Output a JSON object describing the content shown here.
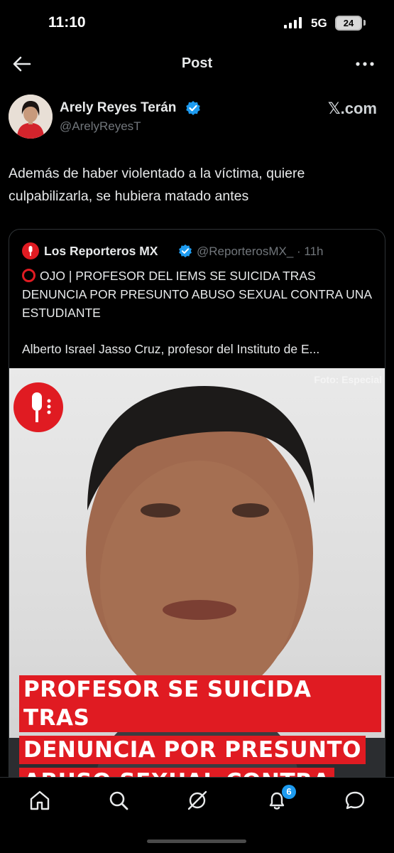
{
  "status_bar": {
    "time": "11:10",
    "network": "5G",
    "battery": "24"
  },
  "header": {
    "title": "Post"
  },
  "author": {
    "name": "Arely Reyes Terán",
    "handle": "@ArelyReyesT",
    "watermark": "𝕏.com"
  },
  "tweet": {
    "text": "Además de haber violentado a la víctima, quiere culpabilizarla, se hubiera matado antes"
  },
  "quote": {
    "name": "Los Reporteros MX",
    "handle": "@ReporterosMX_ · 11h",
    "text": "OJO | PROFESOR DEL IEMS SE SUICIDA TRAS DENUNCIA POR PRESUNTO ABUSO SEXUAL CONTRA UNA ESTUDIANTE",
    "excerpt": "Alberto Israel Jasso Cruz, profesor del Instituto de E...",
    "media": {
      "photo_credit": "Foto: Especial",
      "headline": [
        "PROFESOR SE SUICIDA TRAS",
        "DENUNCIA POR PRESUNTO",
        "ABUSO SEXUAL CONTRA"
      ]
    }
  },
  "nav": {
    "notifications_badge": "6",
    "icons": [
      "home-icon",
      "search-icon",
      "grok-icon",
      "notifications-icon",
      "messages-icon"
    ]
  },
  "colors": {
    "accent": "#1d9bf0",
    "brand_red": "#e01b22",
    "background": "#000000",
    "muted": "#71767b"
  }
}
